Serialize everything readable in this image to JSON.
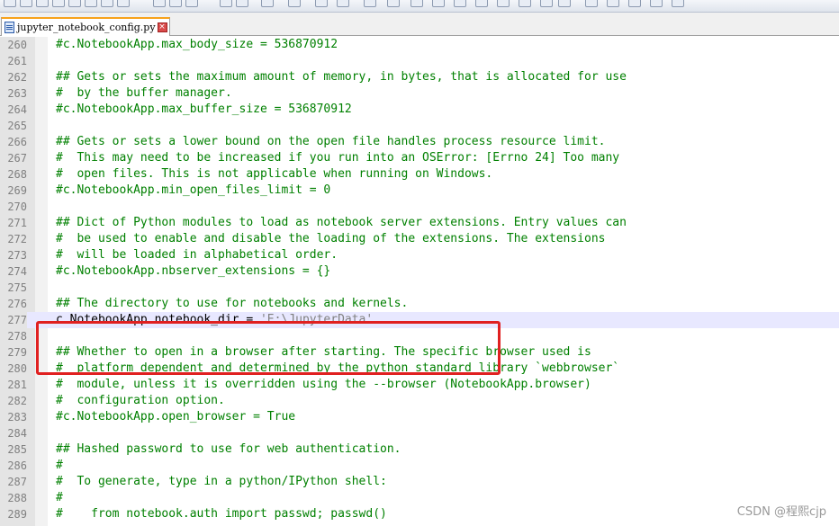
{
  "tab": {
    "filename": "jupyter_notebook_config.py",
    "close_glyph": "×"
  },
  "editor": {
    "lines": [
      {
        "num": "260",
        "text": "#c.NotebookApp.max_body_size = 536870912",
        "kind": "comment"
      },
      {
        "num": "261",
        "text": "",
        "kind": "comment"
      },
      {
        "num": "262",
        "text": "## Gets or sets the maximum amount of memory, in bytes, that is allocated for use",
        "kind": "comment"
      },
      {
        "num": "263",
        "text": "#  by the buffer manager.",
        "kind": "comment"
      },
      {
        "num": "264",
        "text": "#c.NotebookApp.max_buffer_size = 536870912",
        "kind": "comment"
      },
      {
        "num": "265",
        "text": "",
        "kind": "comment"
      },
      {
        "num": "266",
        "text": "## Gets or sets a lower bound on the open file handles process resource limit.",
        "kind": "comment"
      },
      {
        "num": "267",
        "text": "#  This may need to be increased if you run into an OSError: [Errno 24] Too many",
        "kind": "comment"
      },
      {
        "num": "268",
        "text": "#  open files. This is not applicable when running on Windows.",
        "kind": "comment"
      },
      {
        "num": "269",
        "text": "#c.NotebookApp.min_open_files_limit = 0",
        "kind": "comment"
      },
      {
        "num": "270",
        "text": "",
        "kind": "comment"
      },
      {
        "num": "271",
        "text": "## Dict of Python modules to load as notebook server extensions. Entry values can",
        "kind": "comment"
      },
      {
        "num": "272",
        "text": "#  be used to enable and disable the loading of the extensions. The extensions",
        "kind": "comment"
      },
      {
        "num": "273",
        "text": "#  will be loaded in alphabetical order.",
        "kind": "comment"
      },
      {
        "num": "274",
        "text": "#c.NotebookApp.nbserver_extensions = {}",
        "kind": "comment"
      },
      {
        "num": "275",
        "text": "",
        "kind": "comment"
      },
      {
        "num": "276",
        "text": "## The directory to use for notebooks and kernels.",
        "kind": "comment"
      },
      {
        "num": "277",
        "text": "c.NotebookApp.notebook_dir = ",
        "string": "'E:\\JupyterData'",
        "kind": "code",
        "current": true
      },
      {
        "num": "278",
        "text": "",
        "kind": "comment"
      },
      {
        "num": "279",
        "text": "## Whether to open in a browser after starting. The specific browser used is",
        "kind": "comment"
      },
      {
        "num": "280",
        "text": "#  platform dependent and determined by the python standard library `webbrowser`",
        "kind": "comment"
      },
      {
        "num": "281",
        "text": "#  module, unless it is overridden using the --browser (NotebookApp.browser)",
        "kind": "comment"
      },
      {
        "num": "282",
        "text": "#  configuration option.",
        "kind": "comment"
      },
      {
        "num": "283",
        "text": "#c.NotebookApp.open_browser = True",
        "kind": "comment"
      },
      {
        "num": "284",
        "text": "",
        "kind": "comment"
      },
      {
        "num": "285",
        "text": "## Hashed password to use for web authentication.",
        "kind": "comment"
      },
      {
        "num": "286",
        "text": "#",
        "kind": "comment"
      },
      {
        "num": "287",
        "text": "#  To generate, type in a python/IPython shell:",
        "kind": "comment"
      },
      {
        "num": "288",
        "text": "#",
        "kind": "comment"
      },
      {
        "num": "289",
        "text": "#    from notebook.auth import passwd; passwd()",
        "kind": "comment"
      }
    ]
  },
  "watermark": "CSDN @程熙cjp",
  "colors": {
    "comment": "#008000",
    "code": "#000000",
    "string": "#808080",
    "highlight_box": "#e02020",
    "current_line": "#e8e8ff"
  }
}
